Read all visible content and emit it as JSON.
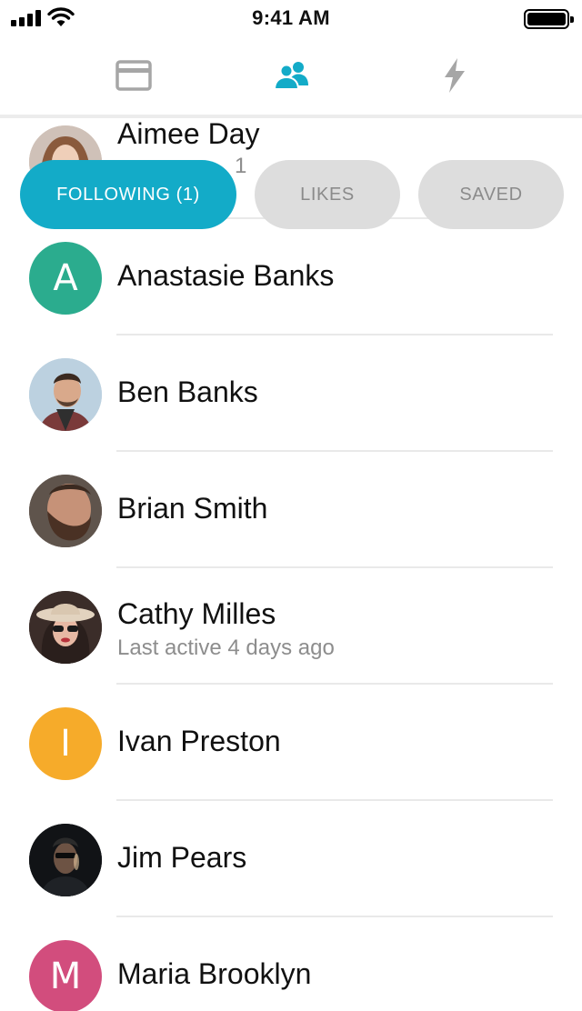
{
  "status_bar": {
    "time": "9:41 AM"
  },
  "nav": {
    "tabs": [
      {
        "icon": "browser-window-icon",
        "active": false
      },
      {
        "icon": "people-icon",
        "active": true
      },
      {
        "icon": "lightning-icon",
        "active": false
      }
    ]
  },
  "filters": [
    {
      "label": "FOLLOWING (1)",
      "active": true
    },
    {
      "label": "LIKES",
      "active": false
    },
    {
      "label": "SAVED",
      "active": false
    }
  ],
  "contacts": [
    {
      "name": "Aimee Day",
      "subtitle": "1",
      "avatar_type": "photo"
    },
    {
      "name": "Anastasie Banks",
      "avatar_type": "letter",
      "letter": "A",
      "color": "#2bac8e"
    },
    {
      "name": "Ben Banks",
      "avatar_type": "photo"
    },
    {
      "name": "Brian Smith",
      "avatar_type": "photo"
    },
    {
      "name": "Cathy Milles",
      "subtitle": "Last active 4 days ago",
      "avatar_type": "photo"
    },
    {
      "name": "Ivan Preston",
      "avatar_type": "letter",
      "letter": "I",
      "color": "#f6ab2a"
    },
    {
      "name": "Jim Pears",
      "avatar_type": "photo"
    },
    {
      "name": "Maria Brooklyn",
      "avatar_type": "letter",
      "letter": "M",
      "color": "#d24d7d"
    }
  ],
  "colors": {
    "accent": "#13abc8",
    "inactive_icon": "#a6a6a6",
    "pill_inactive": "#dddddd"
  }
}
